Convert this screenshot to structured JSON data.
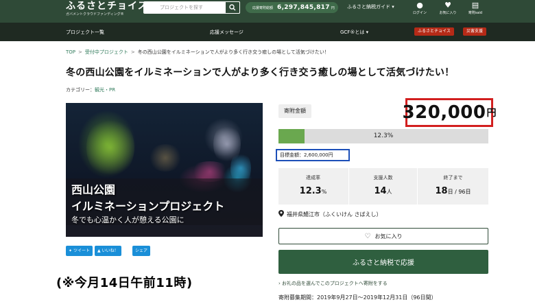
{
  "header": {
    "logo": "ふるさとチョイス",
    "logo_sub": "ガバメントクラウドファンディング®",
    "search_placeholder": "プロジェクトを探す",
    "total_label": "応援寄附総額",
    "total_value": "6,297,845,817",
    "total_unit": "円",
    "guide": "ふるさと納税ガイド",
    "icons": [
      {
        "name": "login",
        "label": "ログイン"
      },
      {
        "name": "favorites",
        "label": "お気に入り"
      },
      {
        "name": "donation-list",
        "label": "寄附said"
      }
    ]
  },
  "nav": {
    "projects": "プロジェクト一覧",
    "messages": "応援メッセージ",
    "gcf": "GCF®とは",
    "pill_choice": "ふるさとチョイス",
    "pill_disaster": "災害支援"
  },
  "breadcrumb": {
    "top": "TOP",
    "accepting": "受付中プロジェクト",
    "current": "冬の西山公園をイルミネーションで人がより多く行き交う癒しの場として活気づけたい！"
  },
  "project": {
    "title": "冬の西山公園をイルミネーションで人がより多く行き交う癒しの場として活気づけたい！",
    "category_label": "カテゴリー：",
    "category": "観光・PR",
    "hero_line1": "西山公園",
    "hero_line2": "イルミネーションプロジェクト",
    "hero_line3": "冬でも心温かく人が憩える公園に"
  },
  "share": {
    "tweet": "ツイート",
    "like": "いいね！",
    "share": "シェア"
  },
  "caption": "(※今月14日午前11時)",
  "funding": {
    "tag": "寄附金額",
    "amount": "320,000",
    "amount_unit": "円",
    "progress_percent": 12.3,
    "progress_label": "12.3%",
    "target": "目標金額：2,600,000円",
    "stats": [
      {
        "label": "達成率",
        "value": "12.3",
        "unit": "%"
      },
      {
        "label": "支援人数",
        "value": "14",
        "unit": "人"
      },
      {
        "label": "終了まで",
        "value": "18",
        "unit": "日 / 96日"
      }
    ],
    "location": "福井県鯖江市（ふくいけん さばえし）",
    "favorite": "お気に入り",
    "donate": "ふるさと納税で応援",
    "gift_link": "お礼の品を選んでこのプロジェクトへ寄附をする",
    "period": "寄附募集期間：2019年9月27日～2019年12月31日（96日間）"
  },
  "colors": {
    "header_bg": "#2f4a37",
    "nav_bg": "#1f2a22",
    "accent_green": "#2f5f3f",
    "progress_fill": "#6aa84f",
    "amount_border": "#d21f1f",
    "target_border": "#1c4fb8",
    "pill_red": "#b52a17",
    "share_blue": "#1a8fd8"
  }
}
